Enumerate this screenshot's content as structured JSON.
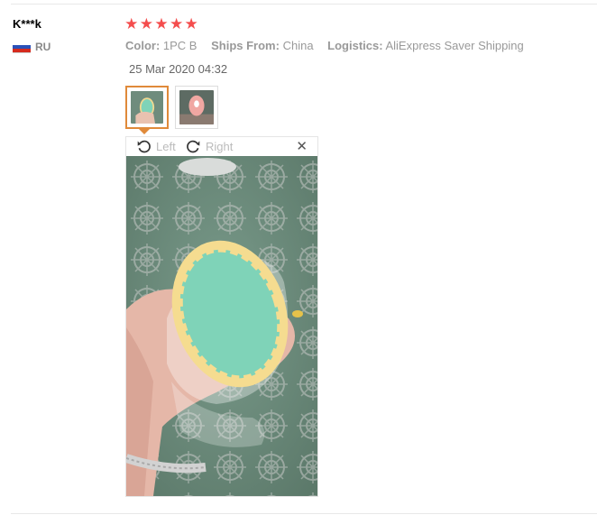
{
  "review": {
    "user": "K***k",
    "country_code": "RU",
    "rating": 5,
    "attributes": [
      {
        "key": "Color:",
        "value": "1PC B"
      },
      {
        "key": "Ships From:",
        "value": "China"
      },
      {
        "key": "Logistics:",
        "value": "AliExpress Saver Shipping"
      }
    ],
    "date": "25 Mar 2020 04:32"
  },
  "viewer": {
    "rotate_left_label": "Left",
    "rotate_right_label": "Right",
    "close_icon": "close-icon",
    "selected_thumbnail": 1
  },
  "colors": {
    "star": "#f44d4d",
    "thumb_selected_border": "#e08a3a",
    "sponge": "#7fd3b8",
    "sponge_edge": "#f6dc8e"
  }
}
